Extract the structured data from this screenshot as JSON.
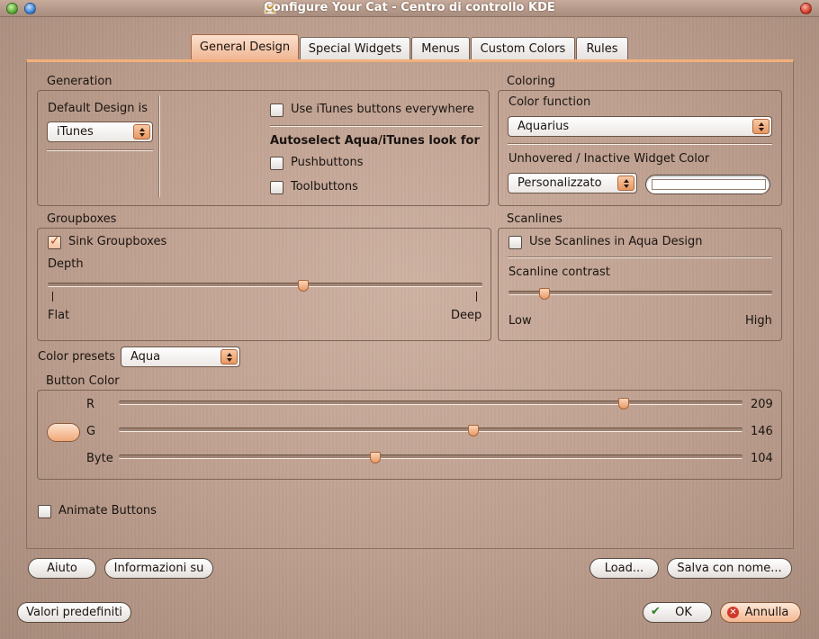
{
  "window": {
    "title": "Configure Your Cat - Centro di controllo KDE"
  },
  "tabs": [
    {
      "label": "General Design",
      "active": true
    },
    {
      "label": "Special Widgets"
    },
    {
      "label": "Menus"
    },
    {
      "label": "Custom Colors"
    },
    {
      "label": "Rules"
    }
  ],
  "generation": {
    "title": "Generation",
    "default_design_label": "Default Design is",
    "default_design_value": "iTunes",
    "itunes_everywhere": {
      "label": "Use iTunes buttons everywhere",
      "checked": false
    },
    "autoselect_heading": "Autoselect Aqua/iTunes look for",
    "pushbuttons": {
      "label": "Pushbuttons",
      "checked": false
    },
    "toolbuttons": {
      "label": "Toolbuttons",
      "checked": false
    }
  },
  "coloring": {
    "title": "Coloring",
    "color_function_label": "Color function",
    "color_function_value": "Aquarius",
    "unhovered_label": "Unhovered / Inactive Widget Color",
    "unhovered_value": "Personalizzato"
  },
  "groupboxes": {
    "title": "Groupboxes",
    "sink": {
      "label": "Sink Groupboxes",
      "checked": true
    },
    "depth_label": "Depth",
    "depth_min_label": "Flat",
    "depth_max_label": "Deep",
    "depth_fraction": 0.59
  },
  "scanlines": {
    "title": "Scanlines",
    "use": {
      "label": "Use Scanlines in Aqua Design",
      "checked": false
    },
    "contrast_label": "Scanline contrast",
    "min_label": "Low",
    "max_label": "High",
    "contrast_fraction": 0.12
  },
  "color_presets": {
    "label": "Color presets",
    "value": "Aqua"
  },
  "button_color": {
    "title": "Button Color",
    "channels": [
      {
        "label": "R",
        "value": "209",
        "fraction": 0.815
      },
      {
        "label": "G",
        "value": "146",
        "fraction": 0.57
      },
      {
        "label": "Byte",
        "value": "104",
        "fraction": 0.41
      }
    ]
  },
  "animate_buttons": {
    "label": "Animate Buttons",
    "checked": false
  },
  "buttons": {
    "help": "Aiuto",
    "about": "Informazioni su",
    "load": "Load...",
    "save_as": "Salva con nome...",
    "defaults": "Valori predefiniti",
    "ok": "OK",
    "cancel": "Annulla"
  },
  "colors": {
    "accent": "#f3b07a",
    "handle": "#e99a66"
  }
}
